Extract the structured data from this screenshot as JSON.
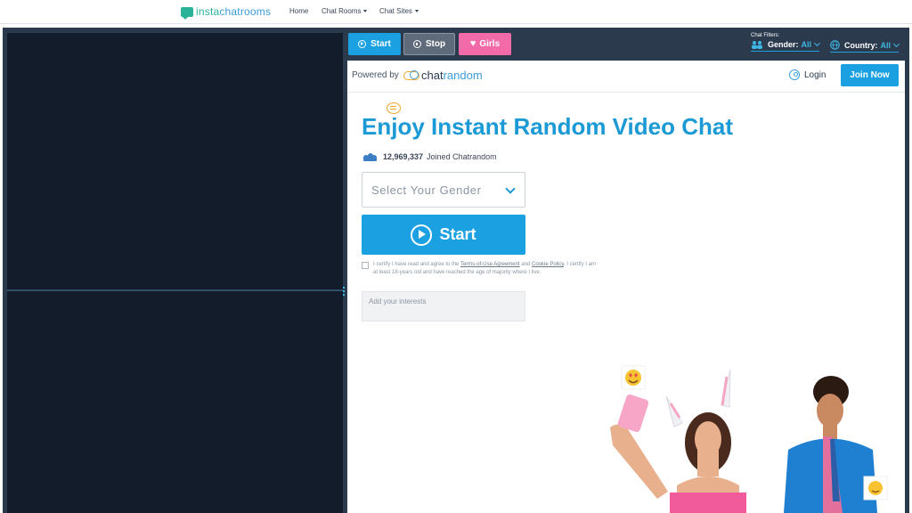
{
  "topnav": {
    "logo_part1": "insta",
    "logo_part2": "chatrooms",
    "home": "Home",
    "chat_rooms": "Chat Rooms",
    "chat_sites": "Chat Sites"
  },
  "controls": {
    "start": "Start",
    "stop": "Stop",
    "girls": "Girls"
  },
  "filters": {
    "label": "Chat Filters:",
    "gender_label": "Gender:",
    "gender_value": "All",
    "country_label": "Country:",
    "country_value": "All"
  },
  "panel": {
    "powered_by": "Powered by",
    "brand_part1": "chat",
    "brand_part2": "random",
    "login": "Login",
    "join": "Join Now",
    "title": "Enjoy Instant Random Video Chat",
    "joined_count": "12,969,337",
    "joined_text": "Joined Chatrandom",
    "select_placeholder": "Select Your Gender",
    "start_button": "Start",
    "cert_part1": "I certify I have read and agree to the ",
    "terms_link": "Terms-of-Use Agreement",
    "cert_and": " and ",
    "cookie_link": "Cookie Policy",
    "cert_part2": ". I certify I am at least 18-years old and have reached the age of majority where I live.",
    "interests_placeholder": "Add your interests"
  },
  "colors": {
    "accent": "#1ba1e2",
    "girls": "#f26ba8",
    "frame": "#2c3a4e",
    "video_bg": "#131c2b"
  }
}
